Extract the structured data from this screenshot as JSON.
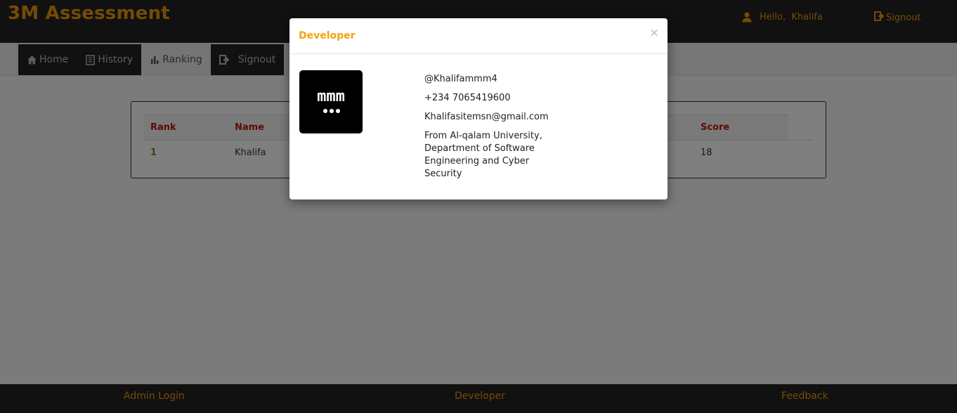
{
  "header": {
    "brand": "3M Assessment",
    "greeting": "Hello,  Khalifa",
    "signout_label": "Signout"
  },
  "nav": {
    "tabs": [
      {
        "label": "Home",
        "icon": "home-icon"
      },
      {
        "label": "History",
        "icon": "history-icon"
      },
      {
        "label": "Ranking",
        "icon": "bar-chart-icon",
        "active": true
      },
      {
        "label": "Signout",
        "icon": "signout-icon"
      }
    ]
  },
  "ranking": {
    "columns": [
      "Rank",
      "Name",
      "Score"
    ],
    "rows": [
      {
        "rank": "1",
        "name": "Khalifa",
        "score": "18"
      }
    ]
  },
  "footer": {
    "admin_login": "Admin Login",
    "developer": "Developer",
    "feedback": "Feedback"
  },
  "modal": {
    "title": "Developer",
    "close": "×",
    "logo_text": "mmm",
    "handle": "@Khalifammm4",
    "phone": "+234 7065419600",
    "email": "Khalifasitemsn@gmail.com",
    "description": "From Al-qalam University, Department of Software Engineering and Cyber Security"
  },
  "colors": {
    "accent": "#e8960c",
    "modal_title": "#f2a20c",
    "table_header": "#c0120c",
    "rank_value": "#5a8a2a",
    "dark_bar": "#222222"
  }
}
